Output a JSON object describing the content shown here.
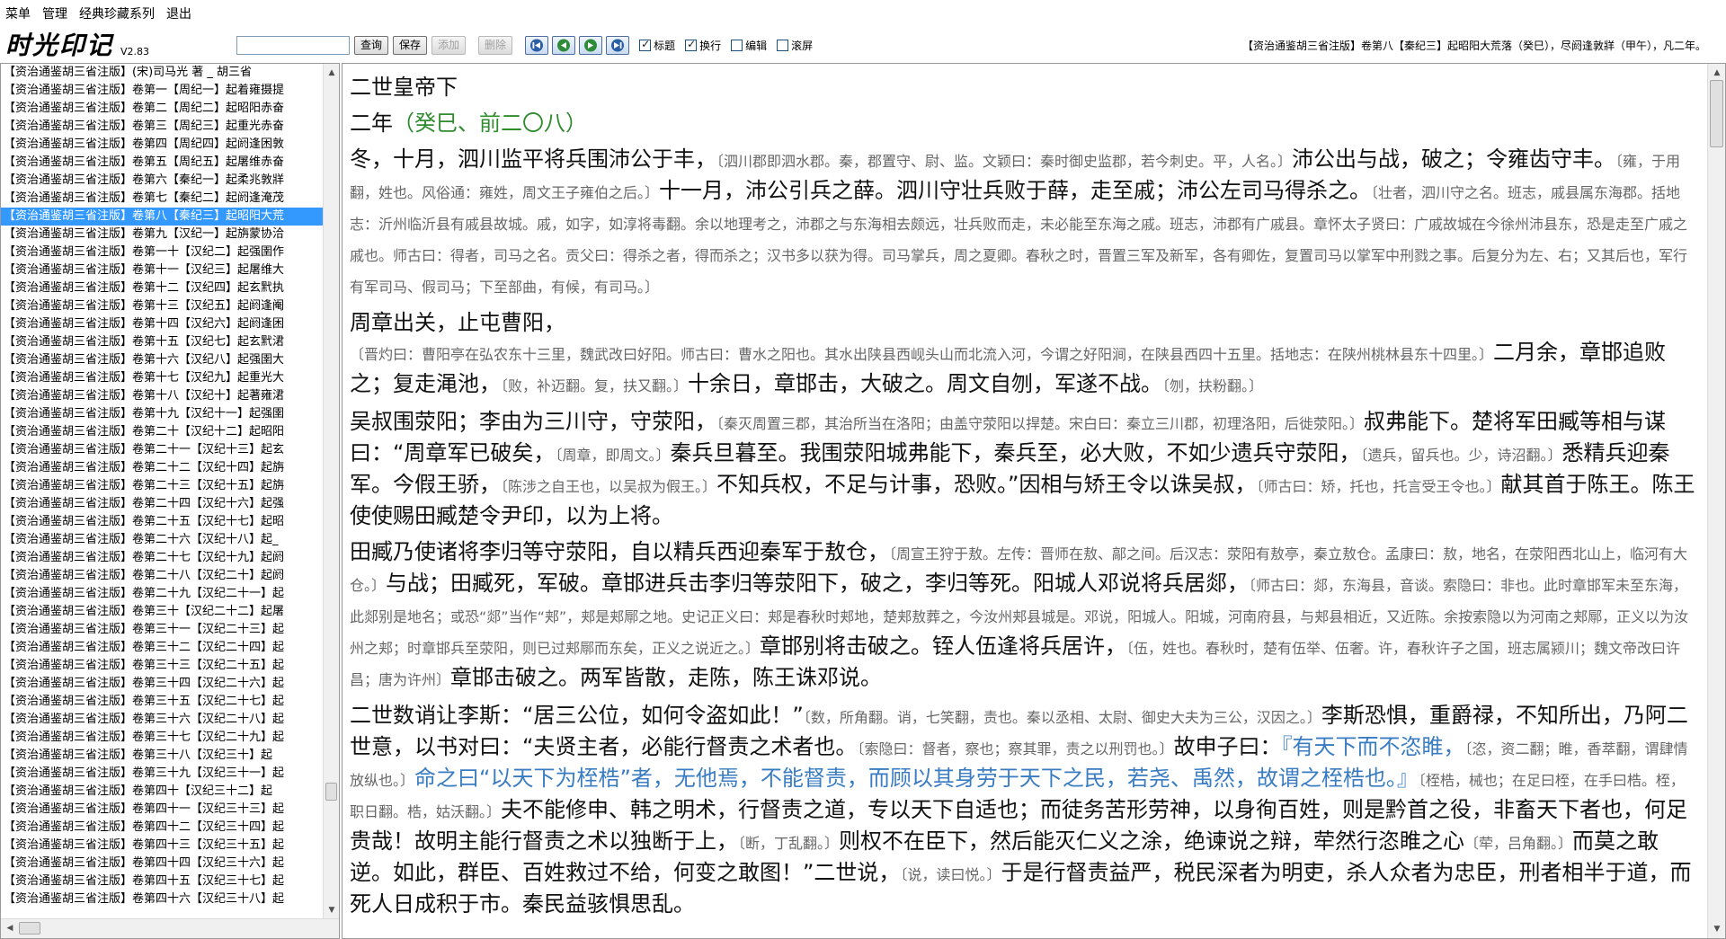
{
  "menu": [
    "菜单",
    "管理",
    "经典珍藏系列",
    "退出"
  ],
  "toolbar": {
    "logo_text": "时光印记",
    "version": "V2.83",
    "search_value": "",
    "query_label": "查询",
    "save_label": "保存",
    "add_label": "添加",
    "delete_label": "删除",
    "checkboxes": [
      {
        "label": "标题",
        "checked": true
      },
      {
        "label": "换行",
        "checked": true
      },
      {
        "label": "编辑",
        "checked": false
      },
      {
        "label": "滚屏",
        "checked": false
      }
    ],
    "doc_title": "【资治通鉴胡三省注版】卷第八【秦纪三】起昭阳大荒落（癸巳），尽阏逢敦牂（甲午），凡二年。"
  },
  "sidebar": {
    "selected_index": 8,
    "items": [
      "【资治通鉴胡三省注版】(宋)司马光 著 _ 胡三省",
      "【资治通鉴胡三省注版】卷第一【周纪一】起着雍摄提",
      "【资治通鉴胡三省注版】卷第二【周纪二】起昭阳赤奋",
      "【资治通鉴胡三省注版】卷第三【周纪三】起重光赤奋",
      "【资治通鉴胡三省注版】卷第四【周纪四】起阏逢困敦",
      "【资治通鉴胡三省注版】卷第五【周纪五】起屠维赤奋",
      "【资治通鉴胡三省注版】卷第六【秦纪一】起柔兆敦牂",
      "【资治通鉴胡三省注版】卷第七【秦纪二】起阏逢淹茂",
      "【资治通鉴胡三省注版】卷第八【秦纪三】起昭阳大荒",
      "【资治通鉴胡三省注版】卷第九【汉纪一】起旃蒙协洽",
      "【资治通鉴胡三省注版】卷第一十【汉纪二】起强圉作",
      "【资治通鉴胡三省注版】卷第十一【汉纪三】起屠维大",
      "【资治通鉴胡三省注版】卷第十二【汉纪四】起玄黓执",
      "【资治通鉴胡三省注版】卷第十三【汉纪五】起阏逢阉",
      "【资治通鉴胡三省注版】卷第十四【汉纪六】起阏逢困",
      "【资治通鉴胡三省注版】卷第十五【汉纪七】起玄黓涒",
      "【资治通鉴胡三省注版】卷第十六【汉纪八】起强圉大",
      "【资治通鉴胡三省注版】卷第十七【汉纪九】起重光大",
      "【资治通鉴胡三省注版】卷第十八【汉纪十】起著雍涒",
      "【资治通鉴胡三省注版】卷第十九【汉纪十一】起强圉",
      "【资治通鉴胡三省注版】卷第二十【汉纪十二】起昭阳",
      "【资治通鉴胡三省注版】卷第二十一【汉纪十三】起玄",
      "【资治通鉴胡三省注版】卷第二十二【汉纪十四】起旃",
      "【资治通鉴胡三省注版】卷第二十三【汉纪十五】起旃",
      "【资治通鉴胡三省注版】卷第二十四【汉纪十六】起强",
      "【资治通鉴胡三省注版】卷第二十五【汉纪十七】起昭",
      "【资治通鉴胡三省注版】卷第二十六【汉纪十八】起_",
      "【资治通鉴胡三省注版】卷第二十七【汉纪十九】起阏",
      "【资治通鉴胡三省注版】卷第二十八【汉纪二十】起阏",
      "【资治通鉴胡三省注版】卷第二十九【汉纪二十一】起",
      "【资治通鉴胡三省注版】卷第三十【汉纪二十二】起屠",
      "【资治通鉴胡三省注版】卷第三十一【汉纪二十三】起",
      "【资治通鉴胡三省注版】卷第三十二【汉纪二十四】起",
      "【资治通鉴胡三省注版】卷第三十三【汉纪二十五】起",
      "【资治通鉴胡三省注版】卷第三十四【汉纪二十六】起",
      "【资治通鉴胡三省注版】卷第三十五【汉纪二十七】起",
      "【资治通鉴胡三省注版】卷第三十六【汉纪二十八】起",
      "【资治通鉴胡三省注版】卷第三十七【汉纪二十九】起",
      "【资治通鉴胡三省注版】卷第三十八【汉纪三十】起",
      "【资治通鉴胡三省注版】卷第三十九【汉纪三十一】起",
      "【资治通鉴胡三省注版】卷第四十【汉纪三十二】起",
      "【资治通鉴胡三省注版】卷第四十一【汉纪三十三】起",
      "【资治通鉴胡三省注版】卷第四十二【汉纪三十四】起",
      "【资治通鉴胡三省注版】卷第四十三【汉纪三十五】起",
      "【资治通鉴胡三省注版】卷第四十四【汉纪三十六】起",
      "【资治通鉴胡三省注版】卷第四十五【汉纪三十七】起",
      "【资治通鉴胡三省注版】卷第四十六【汉纪三十八】起"
    ]
  },
  "content": {
    "paragraphs": [
      [
        {
          "t": "text",
          "v": "二世皇帝下"
        }
      ],
      [
        {
          "t": "text",
          "v": "二年"
        },
        {
          "t": "year",
          "v": "（癸巳、前二〇八）"
        }
      ],
      [
        {
          "t": "text",
          "v": "冬，十月，泗川监平将兵围沛公于丰，"
        },
        {
          "t": "note",
          "v": "〔泗川郡即泗水郡。秦，郡置守、尉、监。文颖曰：秦时御史监郡，若今刺史。平，人名。〕"
        },
        {
          "t": "text",
          "v": "沛公出与战，破之；令雍齿守丰。"
        },
        {
          "t": "note",
          "v": "〔雍，于用翻，姓也。风俗通：雍姓，周文王子雍伯之后。〕"
        },
        {
          "t": "text",
          "v": "十一月，沛公引兵之薛。泗川守壮兵败于薛，走至戚；沛公左司马得杀之。"
        },
        {
          "t": "note",
          "v": "〔壮者，泗川守之名。班志，戚县属东海郡。括地志：沂州临沂县有戚县故城。戚，如字，如淳将毒翻。余以地理考之，沛郡之与东海相去颇远，壮兵败而走，未必能至东海之戚。班志，沛郡有广戚县。章怀太子贤曰：广戚故城在今徐州沛县东，恐是走至广戚之戚也。师古曰：得者，司马之名。贡父曰：得杀之者，得而杀之；汉书多以获为得。司马掌兵，周之夏卿。春秋之时，晋置三军及新军，各有卿佐，复置司马以掌军中刑戮之事。后复分为左、右；又其后也，军行有军司马、假司马；下至部曲，有候，有司马。〕"
        }
      ],
      [
        {
          "t": "text",
          "v": "周章出关，止屯曹阳，"
        },
        {
          "t": "note",
          "v": "〔晋灼曰：曹阳亭在弘农东十三里，魏武改曰好阳。师古曰：曹水之阳也。其水出陕县西岘头山而北流入河，今谓之好阳涧，在陕县西四十五里。括地志：在陕州桃林县东十四里。〕"
        },
        {
          "t": "text",
          "v": "二月余，章邯追败之；复走渑池，"
        },
        {
          "t": "note",
          "v": "〔败，补迈翻。复，扶又翻。〕"
        },
        {
          "t": "text",
          "v": "十余日，章邯击，大破之。周文自刎，军遂不战。"
        },
        {
          "t": "note",
          "v": "〔刎，扶粉翻。〕"
        }
      ],
      [
        {
          "t": "text",
          "v": "吴叔围荥阳；李由为三川守，守荥阳，"
        },
        {
          "t": "note",
          "v": "〔秦灭周置三郡，其治所当在洛阳；由盖守荥阳以捍楚。宋白曰：秦立三川郡，初理洛阳，后徙荥阳。〕"
        },
        {
          "t": "text",
          "v": "叔弗能下。楚将军田臧等相与谋曰：“周章军已破矣，"
        },
        {
          "t": "note",
          "v": "〔周章，即周文。〕"
        },
        {
          "t": "text",
          "v": "秦兵旦暮至。我围荥阳城弗能下，秦兵至，必大败，不如少遗兵守荥阳，"
        },
        {
          "t": "note",
          "v": "〔遗兵，留兵也。少，诗沼翻。〕"
        },
        {
          "t": "text",
          "v": "悉精兵迎秦军。今假王骄，"
        },
        {
          "t": "note",
          "v": "〔陈涉之自王也，以吴叔为假王。〕"
        },
        {
          "t": "text",
          "v": "不知兵权，不足与计事，恐败。”因相与矫王令以诛吴叔，"
        },
        {
          "t": "note",
          "v": "〔师古曰：矫，托也，托言受王令也。〕"
        },
        {
          "t": "text",
          "v": "献其首于陈王。陈王使使赐田臧楚令尹印，以为上将。"
        }
      ],
      [
        {
          "t": "text",
          "v": "田臧乃使诸将李归等守荥阳，自以精兵西迎秦军于敖仓，"
        },
        {
          "t": "note",
          "v": "〔周宣王狩于敖。左传：晋师在敖、鄗之间。后汉志：荥阳有敖亭，秦立敖仓。孟康曰：敖，地名，在荥阳西北山上，临河有大仓。〕"
        },
        {
          "t": "text",
          "v": "与战；田臧死，军破。章邯进兵击李归等荥阳下，破之，李归等死。阳城人邓说将兵居郯，"
        },
        {
          "t": "note",
          "v": "〔师古曰：郯，东海县，音谈。索隐曰：非也。此时章邯军未至东海，此郯别是地名；或恐“郯”当作“郏”，郏是郏鄏之地。史记正义曰：郏是春秋时郏地，楚郏敖葬之，今汝州郏县城是。邓说，阳城人。阳城，河南府县，与郏县相近，又近陈。余按索隐以为河南之郏鄏，正义以为汝州之郏；时章邯兵至荥阳，则已过郏鄏而东矣，正义之说近之。〕"
        },
        {
          "t": "text",
          "v": "章邯别将击破之。铚人伍逢将兵居许，"
        },
        {
          "t": "note",
          "v": "〔伍，姓也。春秋时，楚有伍举、伍奢。许，春秋许子之国，班志属颍川；魏文帝改曰许昌；唐为许州〕"
        },
        {
          "t": "text",
          "v": "章邯击破之。两军皆散，走陈，陈王诛邓说。"
        }
      ],
      [
        {
          "t": "text",
          "v": "二世数诮让李斯：“居三公位，如何令盗如此！”"
        },
        {
          "t": "note",
          "v": "〔数，所角翻。诮，七笑翻，责也。秦以丞相、太尉、御史大夫为三公，汉因之。〕"
        },
        {
          "t": "text",
          "v": "李斯恐惧，重爵禄，不知所出，乃阿二世意，以书对曰：“夫贤主者，必能行督责之术者也。"
        },
        {
          "t": "note",
          "v": "〔索隐曰：督者，察也；察其罪，责之以刑罚也。〕"
        },
        {
          "t": "text",
          "v": "故申子曰："
        },
        {
          "t": "quote",
          "v": "『有天下而不恣睢，"
        },
        {
          "t": "note",
          "v": "〔恣，资二翻；睢，香萃翻，谓肆情放纵也。〕"
        },
        {
          "t": "quote",
          "v": "命之曰“以天下为桎梏”者，无他焉，不能督责，而顾以其身劳于天下之民，若尧、禹然，故谓之桎梏也。』"
        },
        {
          "t": "note",
          "v": "〔桎梏，械也；在足曰桎，在手曰梏。桎，职日翻。梏，姑沃翻。〕"
        },
        {
          "t": "text",
          "v": "夫不能修申、韩之明术，行督责之道，专以天下自适也；而徒务苦形劳神，以身徇百姓，则是黔首之役，非畜天下者也，何足贵哉！故明主能行督责之术以独断于上，"
        },
        {
          "t": "note",
          "v": "〔断，丁乱翻。〕"
        },
        {
          "t": "text",
          "v": "则权不在臣下，然后能灭仁义之涂，绝谏说之辩，荦然行恣睢之心"
        },
        {
          "t": "note",
          "v": "〔荦，吕角翻。〕"
        },
        {
          "t": "text",
          "v": "而莫之敢逆。如此，群臣、百姓救过不给，何变之敢图！”二世说，"
        },
        {
          "t": "note",
          "v": "〔说，读曰悦。〕"
        },
        {
          "t": "text",
          "v": "于是行督责益严，税民深者为明吏，杀人众者为忠臣，刑者相半于道，而死人日成积于市。秦民益骇惧思乱。"
        }
      ]
    ]
  }
}
